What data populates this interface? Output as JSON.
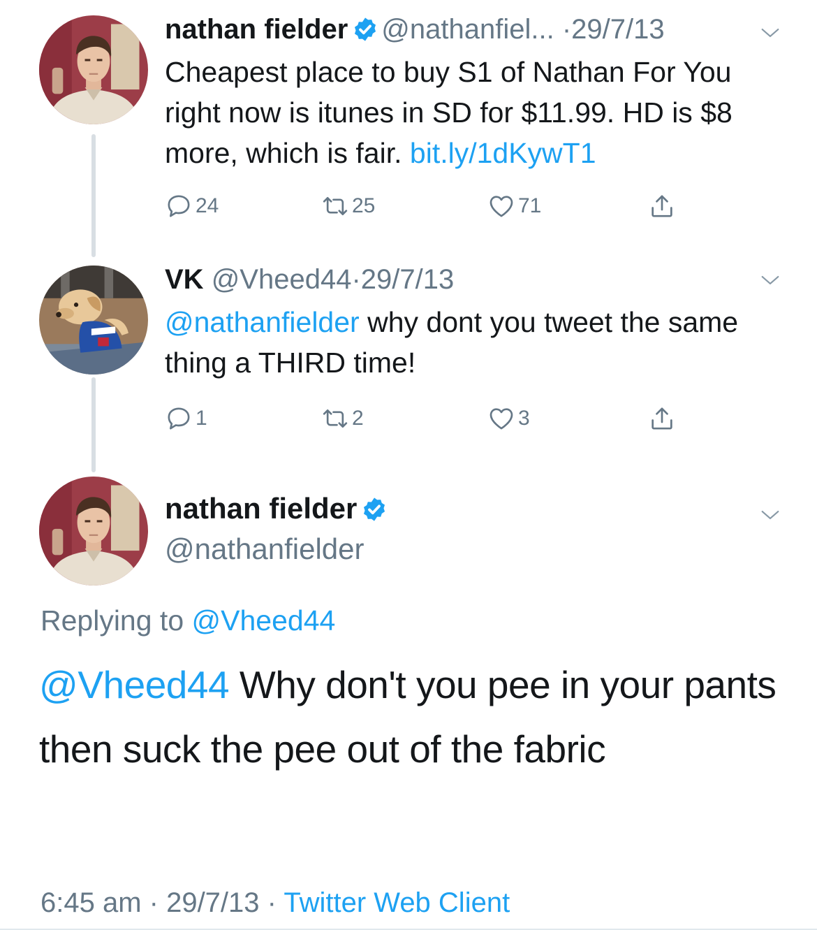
{
  "tweet1": {
    "name": "nathan fielder",
    "handle": "@nathanfiel...",
    "sep": "·",
    "date": "29/7/13",
    "text": "Cheapest place to buy S1 of Nathan For You right now is itunes in SD for $11.99. HD is $8 more, which is fair.",
    "link": "bit.ly/1dKywT1",
    "replies": "24",
    "retweets": "25",
    "likes": "71"
  },
  "tweet2": {
    "name": "VK",
    "handle": "@Vheed44",
    "sep": "·",
    "date": "29/7/13",
    "mention": "@nathanfielder",
    "text": " why dont you tweet the same thing a THIRD time!",
    "replies": "1",
    "retweets": "2",
    "likes": "3"
  },
  "focus": {
    "name": "nathan fielder",
    "handle": "@nathanfielder",
    "replying_prefix": "Replying to ",
    "replying_to": "@Vheed44",
    "mention": "@Vheed44",
    "text": " Why don't you pee in your pants then suck the pee out of the fabric",
    "time": "6:45 am",
    "sep": " · ",
    "date": "29/7/13",
    "source": "Twitter Web Client"
  },
  "icons": {
    "reply": "reply-icon",
    "retweet": "retweet-icon",
    "like": "heart-icon",
    "share": "share-icon",
    "more": "chevron-down-icon",
    "verified": "verified-badge-icon"
  },
  "colors": {
    "link": "#1da1f2",
    "muted": "#657786",
    "text": "#14171a",
    "thread_line": "#d8dee3"
  }
}
